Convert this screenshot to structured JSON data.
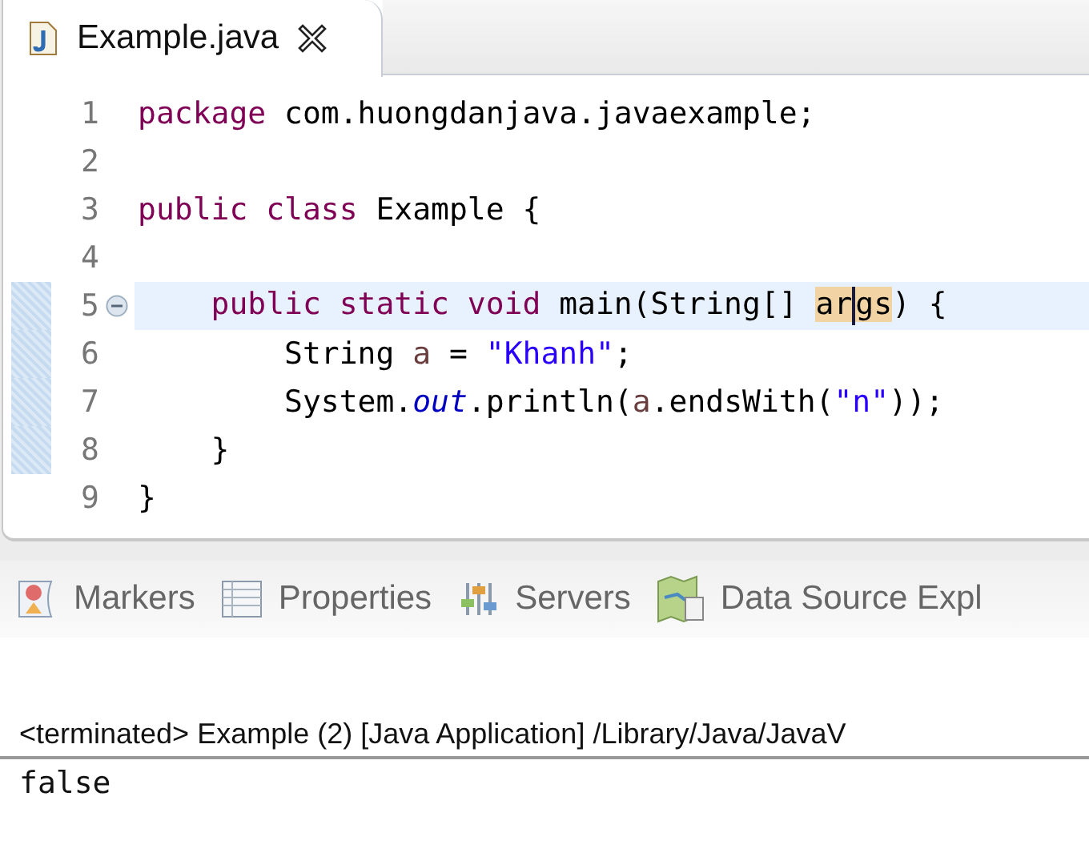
{
  "editor": {
    "tab": {
      "title": "Example.java",
      "selected": true
    },
    "lines": [
      {
        "number": "1",
        "current": false,
        "marked": false,
        "foldable": false,
        "tokens": [
          {
            "text": "package",
            "kind": "keyword"
          },
          {
            "text": " com.huongdanjava.javaexample;",
            "kind": "plain"
          }
        ]
      },
      {
        "number": "2",
        "current": false,
        "marked": false,
        "foldable": false
      },
      {
        "number": "3",
        "current": false,
        "marked": false,
        "foldable": false,
        "tokens": [
          {
            "text": "public",
            "kind": "keyword"
          },
          {
            "text": " class",
            "kind": "keyword"
          },
          {
            "text": " Example {",
            "kind": "plain"
          }
        ]
      },
      {
        "number": "4",
        "current": false,
        "marked": false,
        "foldable": false
      },
      {
        "number": "5",
        "current": true,
        "marked": true,
        "foldable": true,
        "tokens": [
          {
            "text": "    public",
            "kind": "keyword"
          },
          {
            "text": " static",
            "kind": "keyword"
          },
          {
            "text": " void",
            "kind": "keyword"
          },
          {
            "text": " main(String[] ",
            "kind": "plain"
          },
          {
            "text": "ar",
            "kind": "occurrence",
            "caret_after": true
          },
          {
            "text": "gs",
            "kind": "occurrence"
          },
          {
            "text": ") {",
            "kind": "plain"
          }
        ]
      },
      {
        "number": "6",
        "current": false,
        "marked": true,
        "foldable": false,
        "tokens": [
          {
            "text": "        String ",
            "kind": "plain"
          },
          {
            "text": "a",
            "kind": "variable"
          },
          {
            "text": " = ",
            "kind": "plain"
          },
          {
            "text": "\"Khanh\"",
            "kind": "string"
          },
          {
            "text": ";",
            "kind": "plain"
          }
        ]
      },
      {
        "number": "7",
        "current": false,
        "marked": true,
        "foldable": false,
        "tokens": [
          {
            "text": "        System.",
            "kind": "plain"
          },
          {
            "text": "out",
            "kind": "field"
          },
          {
            "text": ".println(",
            "kind": "plain"
          },
          {
            "text": "a",
            "kind": "variable"
          },
          {
            "text": ".endsWith(",
            "kind": "plain"
          },
          {
            "text": "\"n\"",
            "kind": "string"
          },
          {
            "text": "));",
            "kind": "plain"
          }
        ]
      },
      {
        "number": "8",
        "current": false,
        "marked": true,
        "foldable": false,
        "tokens": [
          {
            "text": "    }",
            "kind": "plain"
          }
        ]
      },
      {
        "number": "9",
        "current": false,
        "marked": false,
        "foldable": false,
        "tokens": [
          {
            "text": "}",
            "kind": "plain"
          }
        ]
      }
    ]
  },
  "panel": {
    "tabs": [
      {
        "label": "Markers",
        "kind": "markers"
      },
      {
        "label": "Properties",
        "kind": "properties"
      },
      {
        "label": "Servers",
        "kind": "servers"
      },
      {
        "label": "Data Source Expl",
        "kind": "datasource"
      }
    ],
    "console": {
      "header": "<terminated> Example (2) [Java Application] /Library/Java/JavaV",
      "output": "false"
    }
  }
}
